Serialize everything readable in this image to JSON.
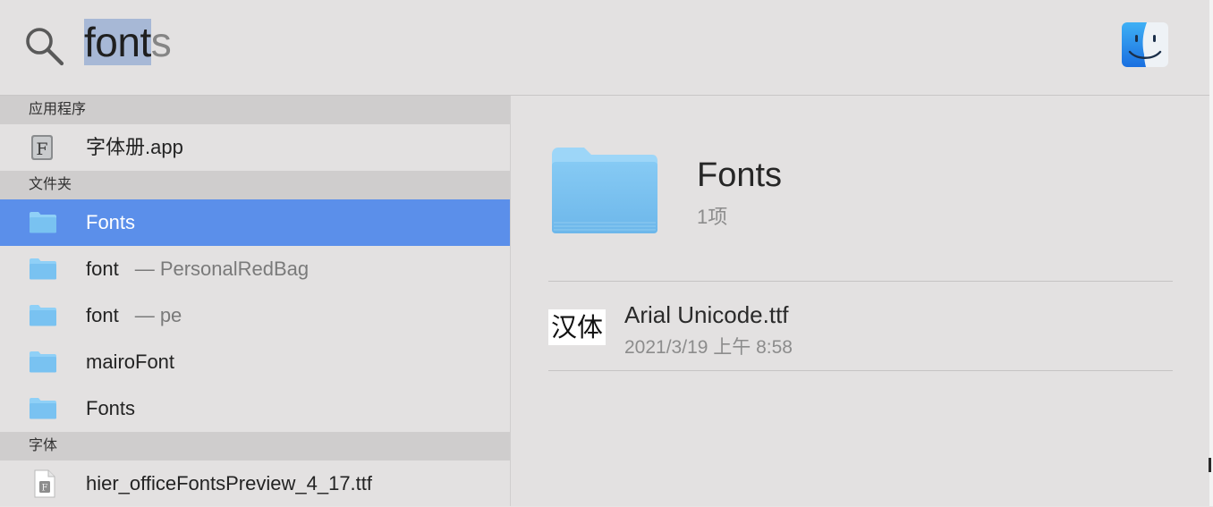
{
  "search": {
    "typed": "font",
    "completion": "s"
  },
  "sections": [
    {
      "header": "应用程序",
      "items": [
        {
          "label": "字体册.app",
          "subtitle": "",
          "icon": "font-book-icon",
          "selected": false
        }
      ]
    },
    {
      "header": "文件夹",
      "items": [
        {
          "label": "Fonts",
          "subtitle": "",
          "icon": "folder-icon",
          "selected": true
        },
        {
          "label": "font",
          "subtitle": "— PersonalRedBag",
          "icon": "folder-icon",
          "selected": false
        },
        {
          "label": "font",
          "subtitle": "— pe",
          "icon": "folder-icon",
          "selected": false
        },
        {
          "label": "mairoFont",
          "subtitle": "",
          "icon": "folder-icon",
          "selected": false
        },
        {
          "label": "Fonts",
          "subtitle": "",
          "icon": "folder-icon",
          "selected": false
        }
      ]
    },
    {
      "header": "字体",
      "items": [
        {
          "label": "hier_officeFontsPreview_4_17.ttf",
          "subtitle": "",
          "icon": "font-file-icon",
          "selected": false
        }
      ]
    }
  ],
  "preview": {
    "title": "Fonts",
    "subtitle": "1项",
    "file": {
      "thumbnail_text": "汉体",
      "name": "Arial Unicode.ttf",
      "date": "2021/3/19 上午 8:58"
    }
  },
  "colors": {
    "selection": "#5b8fea",
    "query_highlight": "#a7b8d6",
    "folder": "#7cc0f0",
    "section_header": "#cfcdcd"
  }
}
